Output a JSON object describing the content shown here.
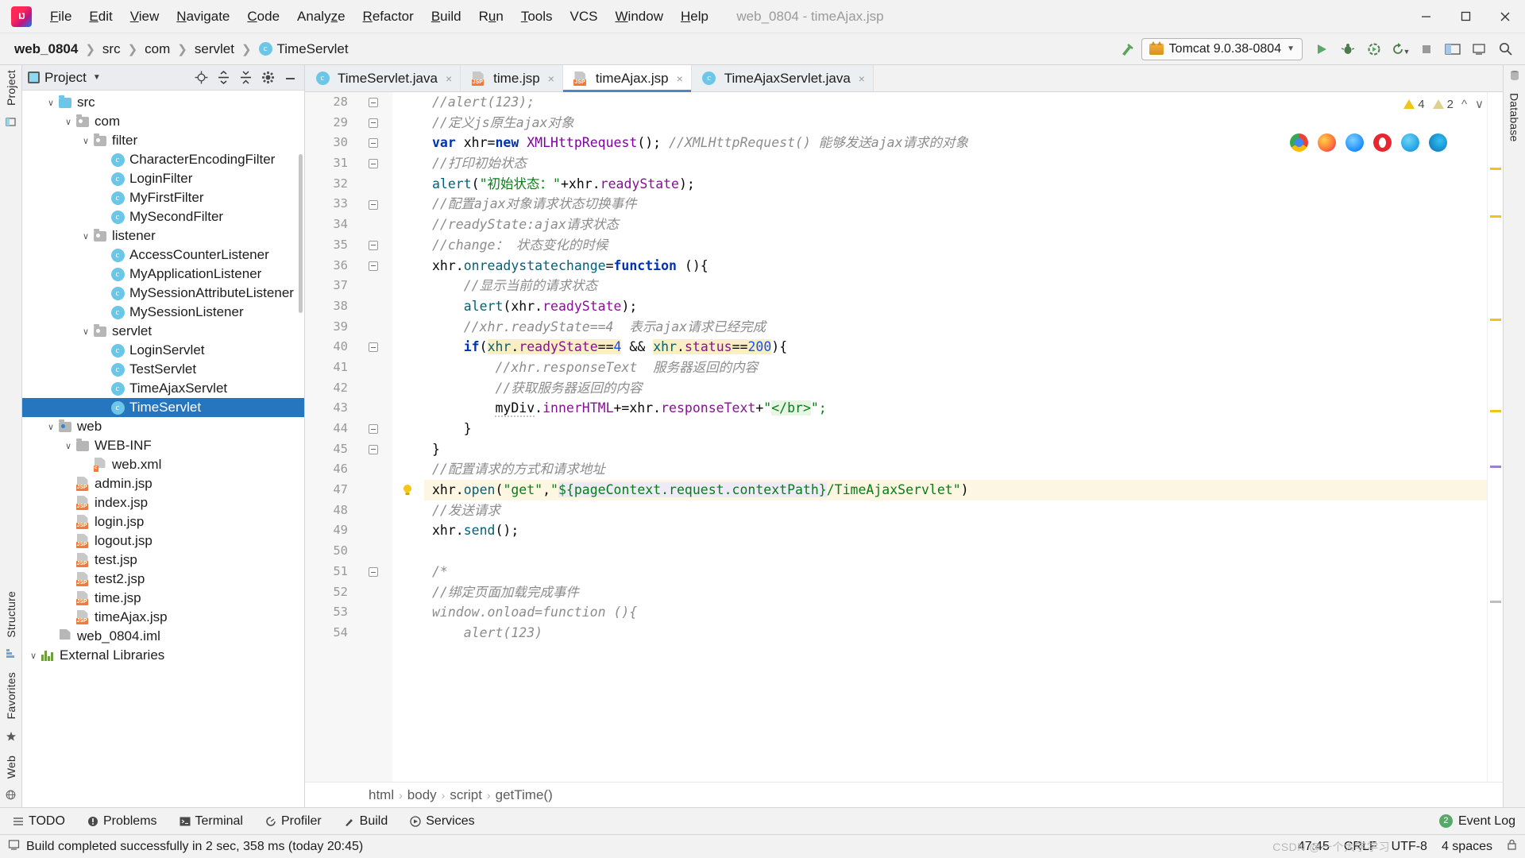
{
  "titlebar": {
    "logo_icon": "intellij-idea-logo",
    "menu": [
      {
        "label": "File",
        "mnemonic": "F"
      },
      {
        "label": "Edit",
        "mnemonic": "E"
      },
      {
        "label": "View",
        "mnemonic": "V"
      },
      {
        "label": "Navigate",
        "mnemonic": "N"
      },
      {
        "label": "Code",
        "mnemonic": "C"
      },
      {
        "label": "Analyze",
        "mnemonic": "z"
      },
      {
        "label": "Refactor",
        "mnemonic": "R"
      },
      {
        "label": "Build",
        "mnemonic": "B"
      },
      {
        "label": "Run",
        "mnemonic": "u"
      },
      {
        "label": "Tools",
        "mnemonic": "T"
      },
      {
        "label": "VCS",
        "mnemonic": ""
      },
      {
        "label": "Window",
        "mnemonic": "W"
      },
      {
        "label": "Help",
        "mnemonic": "H"
      }
    ],
    "window_title": "web_0804 - timeAjax.jsp",
    "minimize_icon": "minimize-icon",
    "maximize_icon": "maximize-icon",
    "close_icon": "close-icon"
  },
  "navbar": {
    "breadcrumbs": [
      {
        "label": "web_0804",
        "icon": "",
        "bold": true
      },
      {
        "label": "src",
        "icon": ""
      },
      {
        "label": "com",
        "icon": ""
      },
      {
        "label": "servlet",
        "icon": ""
      },
      {
        "label": "TimeServlet",
        "icon": "class-icon"
      }
    ],
    "hammer_icon": "build-hammer-icon",
    "run_config": {
      "label": "Tomcat 9.0.38-0804",
      "icon": "tomcat-cat-icon",
      "caret": "▼"
    },
    "actions": [
      {
        "name": "run-button",
        "icon": "▶",
        "color": "#59a869"
      },
      {
        "name": "debug-button",
        "icon": "bug-icon",
        "color": "#3c7a3c"
      },
      {
        "name": "run-with-coverage-button",
        "icon": "coverage-icon",
        "color": "#3a7d3a"
      },
      {
        "name": "run-dashboard-button",
        "icon": "restart-icon",
        "color": "#3a7d3a"
      },
      {
        "name": "stop-button",
        "icon": "■",
        "color": "#9a9a9a"
      },
      {
        "name": "layout-button",
        "icon": "layout-icon",
        "color": "#4a4a4a"
      },
      {
        "name": "update-button",
        "icon": "update-icon",
        "color": "#4a4a4a"
      },
      {
        "name": "search-everywhere-button",
        "icon": "search-icon",
        "color": "#4a4a4a"
      }
    ]
  },
  "left_rail": {
    "top": [
      {
        "label": "Project",
        "name": "rail-project"
      }
    ],
    "bottom": [
      {
        "label": "Structure",
        "name": "rail-structure"
      },
      {
        "label": "Favorites",
        "name": "rail-favorites"
      },
      {
        "label": "Web",
        "name": "rail-web"
      }
    ]
  },
  "right_rail": {
    "items": [
      {
        "label": "Database",
        "name": "rail-database"
      }
    ]
  },
  "project": {
    "header": {
      "title": "Project",
      "caret": "▼",
      "buttons": [
        {
          "name": "locate-file-icon",
          "glyph": "⊕"
        },
        {
          "name": "expand-all-icon",
          "glyph": "↧"
        },
        {
          "name": "collapse-all-icon",
          "glyph": "↥"
        },
        {
          "name": "settings-gear-icon",
          "glyph": "⚙"
        },
        {
          "name": "hide-panel-icon",
          "glyph": "—"
        }
      ]
    },
    "tree": [
      {
        "label": "src",
        "indent": 1,
        "chev": "∨",
        "icon": "folder-source-blue",
        "selected": false
      },
      {
        "label": "com",
        "indent": 2,
        "chev": "∨",
        "icon": "folder-package",
        "selected": false
      },
      {
        "label": "filter",
        "indent": 3,
        "chev": "∨",
        "icon": "folder-package",
        "selected": false
      },
      {
        "label": "CharacterEncodingFilter",
        "indent": 4,
        "chev": "",
        "icon": "java-class",
        "selected": false
      },
      {
        "label": "LoginFilter",
        "indent": 4,
        "chev": "",
        "icon": "java-class",
        "selected": false
      },
      {
        "label": "MyFirstFilter",
        "indent": 4,
        "chev": "",
        "icon": "java-class",
        "selected": false
      },
      {
        "label": "MySecondFilter",
        "indent": 4,
        "chev": "",
        "icon": "java-class",
        "selected": false
      },
      {
        "label": "listener",
        "indent": 3,
        "chev": "∨",
        "icon": "folder-package",
        "selected": false
      },
      {
        "label": "AccessCounterListener",
        "indent": 4,
        "chev": "",
        "icon": "java-class",
        "selected": false
      },
      {
        "label": "MyApplicationListener",
        "indent": 4,
        "chev": "",
        "icon": "java-class",
        "selected": false
      },
      {
        "label": "MySessionAttributeListener",
        "indent": 4,
        "chev": "",
        "icon": "java-class",
        "selected": false
      },
      {
        "label": "MySessionListener",
        "indent": 4,
        "chev": "",
        "icon": "java-class",
        "selected": false
      },
      {
        "label": "servlet",
        "indent": 3,
        "chev": "∨",
        "icon": "folder-package",
        "selected": false
      },
      {
        "label": "LoginServlet",
        "indent": 4,
        "chev": "",
        "icon": "java-class",
        "selected": false
      },
      {
        "label": "TestServlet",
        "indent": 4,
        "chev": "",
        "icon": "java-class",
        "selected": false
      },
      {
        "label": "TimeAjaxServlet",
        "indent": 4,
        "chev": "",
        "icon": "java-class",
        "selected": false
      },
      {
        "label": "TimeServlet",
        "indent": 4,
        "chev": "",
        "icon": "java-class",
        "selected": true
      },
      {
        "label": "web",
        "indent": 1,
        "chev": "∨",
        "icon": "folder-web",
        "selected": false
      },
      {
        "label": "WEB-INF",
        "indent": 2,
        "chev": "∨",
        "icon": "folder-plain",
        "selected": false
      },
      {
        "label": "web.xml",
        "indent": 3,
        "chev": "",
        "icon": "xml-file",
        "selected": false
      },
      {
        "label": "admin.jsp",
        "indent": 2,
        "chev": "",
        "icon": "jsp-file",
        "selected": false
      },
      {
        "label": "index.jsp",
        "indent": 2,
        "chev": "",
        "icon": "jsp-file",
        "selected": false
      },
      {
        "label": "login.jsp",
        "indent": 2,
        "chev": "",
        "icon": "jsp-file",
        "selected": false
      },
      {
        "label": "logout.jsp",
        "indent": 2,
        "chev": "",
        "icon": "jsp-file",
        "selected": false
      },
      {
        "label": "test.jsp",
        "indent": 2,
        "chev": "",
        "icon": "jsp-file",
        "selected": false
      },
      {
        "label": "test2.jsp",
        "indent": 2,
        "chev": "",
        "icon": "jsp-file",
        "selected": false
      },
      {
        "label": "time.jsp",
        "indent": 2,
        "chev": "",
        "icon": "jsp-file",
        "selected": false
      },
      {
        "label": "timeAjax.jsp",
        "indent": 2,
        "chev": "",
        "icon": "jsp-file",
        "selected": false
      },
      {
        "label": "web_0804.iml",
        "indent": 1,
        "chev": "",
        "icon": "iml-file",
        "selected": false
      },
      {
        "label": "External Libraries",
        "indent": 0,
        "chev": "∨",
        "icon": "library-icon",
        "selected": false
      }
    ]
  },
  "editor": {
    "tabs": [
      {
        "label": "TimeServlet.java",
        "icon": "java-class",
        "active": false,
        "close": "×"
      },
      {
        "label": "time.jsp",
        "icon": "jsp-file",
        "active": false,
        "close": "×"
      },
      {
        "label": "timeAjax.jsp",
        "icon": "jsp-file",
        "active": true,
        "close": "×"
      },
      {
        "label": "TimeAjaxServlet.java",
        "icon": "java-class",
        "active": false,
        "close": "×"
      }
    ],
    "inspection": {
      "warning_count": "4",
      "weak_warning_count": "2",
      "warning_icon": "warning-triangle-icon",
      "weak_warning_icon": "weak-warning-triangle-icon",
      "prev_icon": "⌃",
      "next_icon": "⌄"
    },
    "browsers": [
      {
        "name": "open-in-chrome-icon",
        "color": "#f5b400"
      },
      {
        "name": "open-in-firefox-icon",
        "color": "#ff9500"
      },
      {
        "name": "open-in-safari-icon",
        "color": "#1a8cff"
      },
      {
        "name": "open-in-opera-icon",
        "color": "#e8262f"
      },
      {
        "name": "open-in-ie-icon",
        "color": "#29a8e0"
      },
      {
        "name": "open-in-edge-icon",
        "color": "#1b9de2"
      }
    ],
    "first_line_number": 28,
    "lines": [
      {
        "n": 28,
        "fold": true,
        "indent": 0,
        "tokens": [
          {
            "t": "//alert(123);",
            "c": "cmt"
          }
        ]
      },
      {
        "n": 29,
        "fold": "collapsed",
        "indent": 0,
        "tokens": [
          {
            "t": "//定义js原生ajax对象",
            "c": "cmt"
          }
        ]
      },
      {
        "n": 30,
        "fold": true,
        "indent": 0,
        "tokens": [
          {
            "t": "var",
            "c": "kw"
          },
          {
            "t": " xhr=",
            "c": "plain"
          },
          {
            "t": "new",
            "c": "kw"
          },
          {
            "t": " ",
            "c": "plain"
          },
          {
            "t": "XMLHttpRequest",
            "c": "cls"
          },
          {
            "t": "(); ",
            "c": "plain"
          },
          {
            "t": "//XMLHttpRequest() 能够发送ajax请求的对象",
            "c": "cmt"
          }
        ]
      },
      {
        "n": 31,
        "fold": "collapsed",
        "indent": 0,
        "tokens": [
          {
            "t": "//打印初始状态",
            "c": "cmt"
          }
        ]
      },
      {
        "n": 32,
        "fold": false,
        "indent": 0,
        "tokens": [
          {
            "t": "alert",
            "c": "fn"
          },
          {
            "t": "(",
            "c": "plain"
          },
          {
            "t": "\"初始状态：\"",
            "c": "str"
          },
          {
            "t": "+xhr.",
            "c": "plain"
          },
          {
            "t": "readyState",
            "c": "prop"
          },
          {
            "t": ");",
            "c": "plain"
          }
        ]
      },
      {
        "n": 33,
        "fold": true,
        "indent": 0,
        "tokens": [
          {
            "t": "//配置ajax对象请求状态切换事件",
            "c": "cmt"
          }
        ]
      },
      {
        "n": 34,
        "fold": false,
        "indent": 0,
        "tokens": [
          {
            "t": "//readyState:ajax请求状态",
            "c": "cmt"
          }
        ]
      },
      {
        "n": 35,
        "fold": "collapsed",
        "indent": 0,
        "tokens": [
          {
            "t": "//change： 状态变化的时候",
            "c": "cmt"
          }
        ]
      },
      {
        "n": 36,
        "fold": "collapsed",
        "indent": 0,
        "tokens": [
          {
            "t": "xhr.",
            "c": "plain"
          },
          {
            "t": "onreadystatechange",
            "c": "fn"
          },
          {
            "t": "=",
            "c": "plain"
          },
          {
            "t": "function",
            "c": "kw"
          },
          {
            "t": " (){",
            "c": "plain"
          }
        ]
      },
      {
        "n": 37,
        "fold": false,
        "indent": 1,
        "tokens": [
          {
            "t": "//显示当前的请求状态",
            "c": "cmt"
          }
        ]
      },
      {
        "n": 38,
        "fold": false,
        "indent": 1,
        "tokens": [
          {
            "t": "alert",
            "c": "fn"
          },
          {
            "t": "(xhr.",
            "c": "plain"
          },
          {
            "t": "readyState",
            "c": "prop"
          },
          {
            "t": ");",
            "c": "plain"
          }
        ]
      },
      {
        "n": 39,
        "fold": false,
        "indent": 1,
        "tokens": [
          {
            "t": "//xhr.readyState==4  表示ajax请求已经完成",
            "c": "cmt"
          }
        ]
      },
      {
        "n": 40,
        "fold": true,
        "indent": 1,
        "tokens": [
          {
            "t": "if",
            "c": "kw"
          },
          {
            "t": "(",
            "c": "plain"
          },
          {
            "t": "xhr.readyState==4",
            "c": "mark-xhr"
          },
          {
            "t": " && ",
            "c": "plain"
          },
          {
            "t": "xhr.status==200",
            "c": "mark-xhr2"
          },
          {
            "t": "){",
            "c": "plain"
          }
        ]
      },
      {
        "n": 41,
        "fold": false,
        "indent": 2,
        "tokens": [
          {
            "t": "//xhr.responseText  服务器返回的内容",
            "c": "cmt"
          }
        ]
      },
      {
        "n": 42,
        "fold": false,
        "indent": 2,
        "tokens": [
          {
            "t": "//获取服务器返回的内容",
            "c": "cmt"
          }
        ]
      },
      {
        "n": 43,
        "fold": false,
        "indent": 2,
        "tokens": [
          {
            "t": "myDiv",
            "c": "plainsq"
          },
          {
            "t": ".",
            "c": "plain"
          },
          {
            "t": "innerHTML",
            "c": "prop"
          },
          {
            "t": "+=xhr.",
            "c": "plain"
          },
          {
            "t": "responseText",
            "c": "prop"
          },
          {
            "t": "+",
            "c": "plain"
          },
          {
            "t": "\"",
            "c": "str"
          },
          {
            "t": "</br>",
            "c": "strgreen"
          },
          {
            "t": "\";",
            "c": "str"
          }
        ]
      },
      {
        "n": 44,
        "fold": true,
        "indent": 1,
        "tokens": [
          {
            "t": "}",
            "c": "plain"
          }
        ]
      },
      {
        "n": 45,
        "fold": true,
        "indent": 0,
        "tokens": [
          {
            "t": "}",
            "c": "plain"
          }
        ]
      },
      {
        "n": 46,
        "fold": false,
        "indent": 0,
        "tokens": [
          {
            "t": "//配置请求的方式和请求地址",
            "c": "cmt"
          }
        ]
      },
      {
        "n": 47,
        "fold": false,
        "indent": 0,
        "highlight": true,
        "bulb": true,
        "tokens": [
          {
            "t": "xhr.",
            "c": "plain"
          },
          {
            "t": "open",
            "c": "fn"
          },
          {
            "t": "(",
            "c": "plain"
          },
          {
            "t": "\"get\"",
            "c": "str"
          },
          {
            "t": ",",
            "c": "plain"
          },
          {
            "t": "\"",
            "c": "str"
          },
          {
            "t": "${pageContext.request.contextPath}",
            "c": "el"
          },
          {
            "t": "/TimeAjaxServlet\"",
            "c": "str"
          },
          {
            "t": ")",
            "c": "plain"
          }
        ]
      },
      {
        "n": 48,
        "fold": false,
        "indent": 0,
        "tokens": [
          {
            "t": "//发送请求",
            "c": "cmt"
          }
        ]
      },
      {
        "n": 49,
        "fold": false,
        "indent": 0,
        "tokens": [
          {
            "t": "xhr.",
            "c": "plain"
          },
          {
            "t": "send",
            "c": "fn"
          },
          {
            "t": "();",
            "c": "plain"
          }
        ]
      },
      {
        "n": 50,
        "fold": false,
        "indent": 0,
        "tokens": []
      },
      {
        "n": 51,
        "fold": true,
        "indent": 0,
        "tokens": [
          {
            "t": "/*",
            "c": "cmt"
          }
        ]
      },
      {
        "n": 52,
        "fold": false,
        "indent": 0,
        "tokens": [
          {
            "t": "//绑定页面加载完成事件",
            "c": "cmt"
          }
        ]
      },
      {
        "n": 53,
        "fold": false,
        "indent": 0,
        "tokens": [
          {
            "t": "window.onload=function (){",
            "c": "cmt"
          }
        ]
      },
      {
        "n": 54,
        "fold": false,
        "indent": 1,
        "tokens": [
          {
            "t": "alert(123)",
            "c": "cmt"
          }
        ]
      }
    ],
    "breadcrumbs": [
      "html",
      "body",
      "script",
      "getTime()"
    ]
  },
  "bottom_toolbar": {
    "items": [
      {
        "label": "TODO",
        "icon": "todo-list-icon"
      },
      {
        "label": "Problems",
        "icon": "problems-icon"
      },
      {
        "label": "Terminal",
        "icon": "terminal-icon"
      },
      {
        "label": "Profiler",
        "icon": "profiler-icon"
      },
      {
        "label": "Build",
        "icon": "build-hammer-icon"
      },
      {
        "label": "Services",
        "icon": "services-icon"
      }
    ],
    "event_log": {
      "label": "Event Log",
      "badge": "2",
      "icon": "event-log-icon"
    }
  },
  "statusbar": {
    "message": "Build completed successfully in 2 sec, 358 ms (today 20:45)",
    "message_icon": "build-status-icon",
    "caret_position": "47:45",
    "line_separator": "CRLF",
    "encoding": "UTF-8",
    "indent": "4 spaces",
    "watermark": "CSDN @一个大学学习",
    "lock_icon": "lock-icon"
  }
}
